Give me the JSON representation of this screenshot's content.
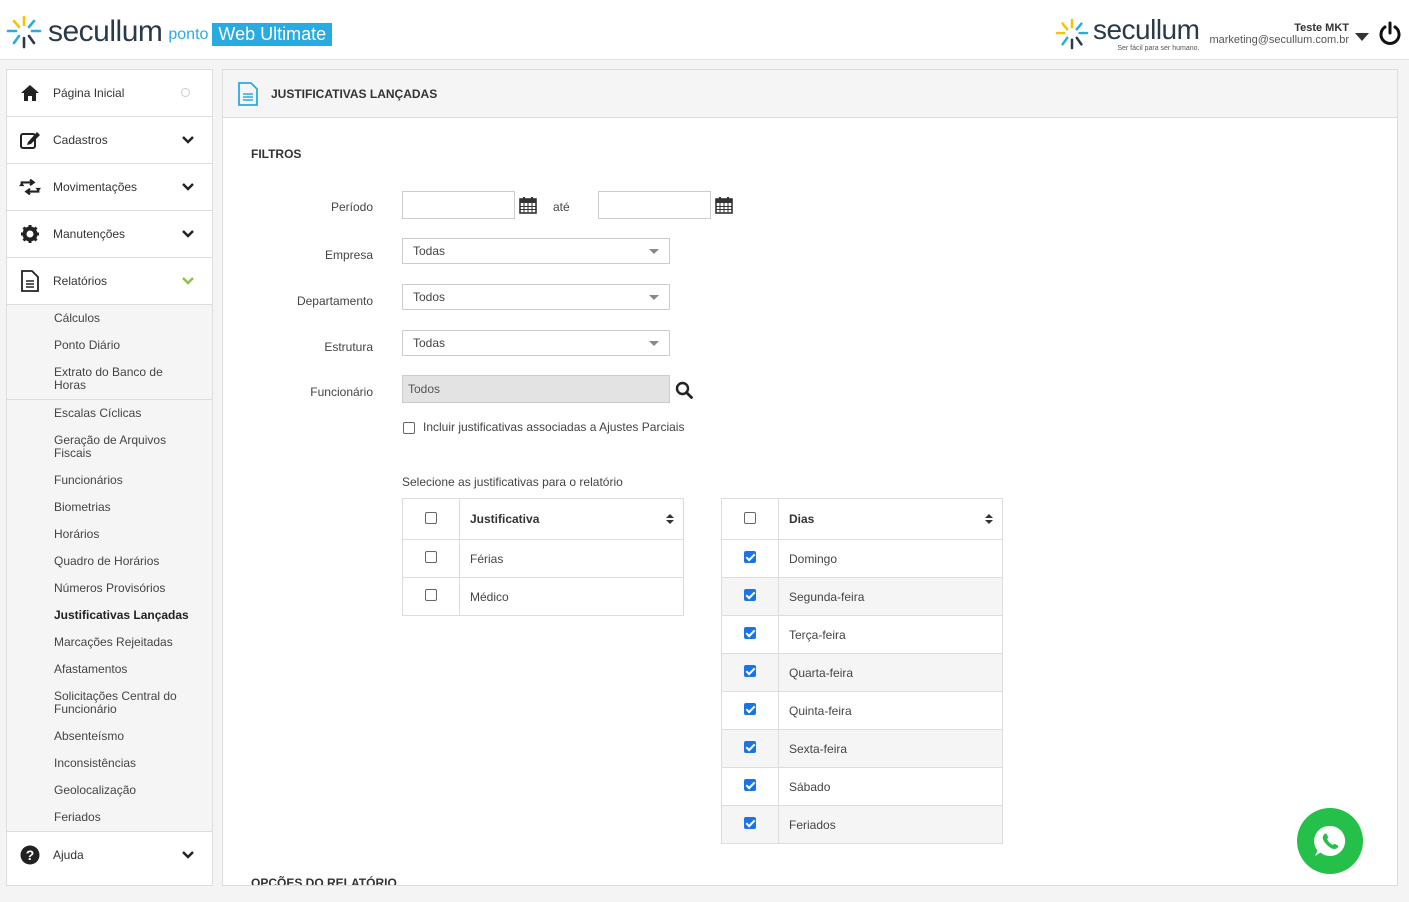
{
  "header": {
    "brand": "secullum",
    "product": "ponto",
    "edition": "Web Ultimate",
    "right_brand": "secullum",
    "right_slogan": "Ser fácil para ser humano.",
    "user_name": "Teste MKT",
    "user_email": "marketing@secullum.com.br"
  },
  "sidebar": {
    "items": [
      {
        "label": "Página Inicial"
      },
      {
        "label": "Cadastros"
      },
      {
        "label": "Movimentações"
      },
      {
        "label": "Manutenções"
      },
      {
        "label": "Relatórios"
      },
      {
        "label": "Ajuda"
      }
    ],
    "reports": [
      "Cálculos",
      "Ponto Diário",
      "Extrato do Banco de Horas",
      "Escalas Cíclicas",
      "Geração de Arquivos Fiscais",
      "Funcionários",
      "Biometrias",
      "Horários",
      "Quadro de Horários",
      "Números Provisórios",
      "Justificativas Lançadas",
      "Marcações Rejeitadas",
      "Afastamentos",
      "Solicitações Central do Funcionário",
      "Absenteísmo",
      "Inconsistências",
      "Geolocalização",
      "Feriados"
    ]
  },
  "page": {
    "title": "JUSTIFICATIVAS LANÇADAS",
    "filters_title": "FILTROS",
    "period_label": "Período",
    "period_start": "",
    "period_sep": "até",
    "period_end": "",
    "company_label": "Empresa",
    "company_value": "Todas",
    "department_label": "Departamento",
    "department_value": "Todos",
    "structure_label": "Estrutura",
    "structure_value": "Todas",
    "employee_label": "Funcionário",
    "employee_value": "Todos",
    "include_partial_label": "Incluir justificativas associadas a Ajustes Parciais",
    "include_partial_checked": false,
    "select_label": "Selecione as justificativas para o relatório",
    "report_options_title": "OPÇÕES DO RELATÓRIO"
  },
  "justificativas": {
    "header": "Justificativa",
    "rows": [
      {
        "name": "Férias",
        "checked": false
      },
      {
        "name": "Médico",
        "checked": false
      }
    ]
  },
  "dias": {
    "header": "Dias",
    "rows": [
      {
        "name": "Domingo",
        "checked": true
      },
      {
        "name": "Segunda-feira",
        "checked": true
      },
      {
        "name": "Terça-feira",
        "checked": true
      },
      {
        "name": "Quarta-feira",
        "checked": true
      },
      {
        "name": "Quinta-feira",
        "checked": true
      },
      {
        "name": "Sexta-feira",
        "checked": true
      },
      {
        "name": "Sábado",
        "checked": true
      },
      {
        "name": "Feriados",
        "checked": true
      }
    ]
  },
  "colors": {
    "accent": "#29abe2",
    "check": "#1a73e8",
    "whatsapp": "#25c04a",
    "sun_yellow": "#f5c400"
  }
}
